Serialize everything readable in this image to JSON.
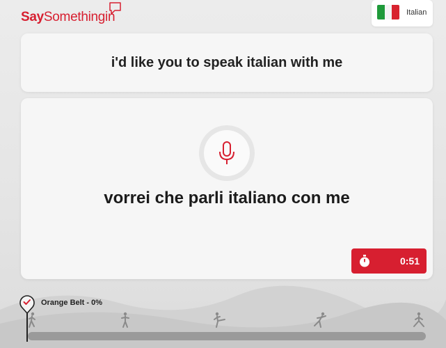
{
  "header": {
    "logo_say": "Say",
    "logo_rest": "Somethingin",
    "language": {
      "label": "Italian",
      "flag_colors": [
        "#1f9a3a",
        "#f4f4f4",
        "#d8232f"
      ]
    }
  },
  "prompt": {
    "text": "i'd like you to speak italian with me"
  },
  "answer": {
    "text": "vorrei che parli italiano con me",
    "mic_icon": "microphone-icon",
    "timer": "0:51"
  },
  "progress": {
    "belt_label": "Orange Belt - 0%",
    "percent": 0,
    "milestone_icons": [
      "martial-arts-figure-1-icon",
      "martial-arts-figure-2-icon",
      "martial-arts-figure-3-icon",
      "martial-arts-figure-4-icon",
      "martial-arts-figure-5-icon"
    ]
  },
  "colors": {
    "brand_red": "#d71f30",
    "card_bg": "#f6f6f6",
    "page_bg": "#e8e8e8"
  }
}
